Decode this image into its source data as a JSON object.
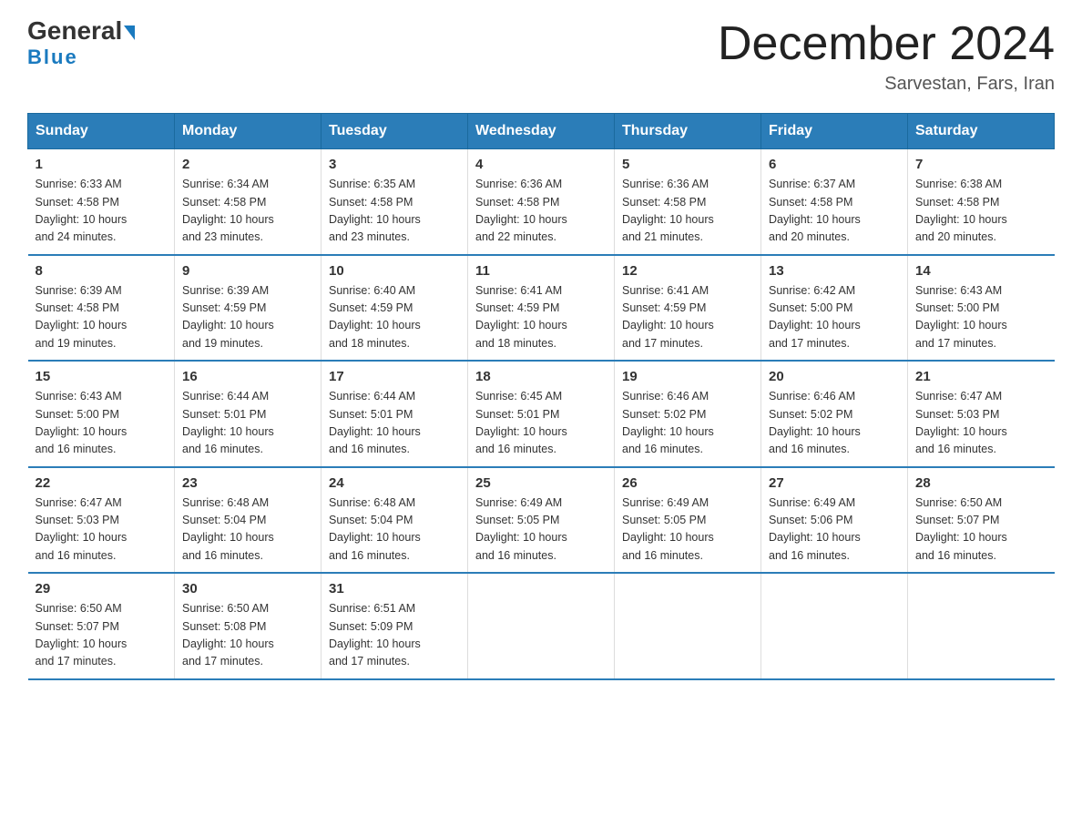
{
  "logo": {
    "part1": "General",
    "part2": "Blue"
  },
  "header": {
    "title": "December 2024",
    "subtitle": "Sarvestan, Fars, Iran"
  },
  "days_of_week": [
    "Sunday",
    "Monday",
    "Tuesday",
    "Wednesday",
    "Thursday",
    "Friday",
    "Saturday"
  ],
  "weeks": [
    [
      {
        "day": "1",
        "sunrise": "6:33 AM",
        "sunset": "4:58 PM",
        "daylight": "10 hours and 24 minutes."
      },
      {
        "day": "2",
        "sunrise": "6:34 AM",
        "sunset": "4:58 PM",
        "daylight": "10 hours and 23 minutes."
      },
      {
        "day": "3",
        "sunrise": "6:35 AM",
        "sunset": "4:58 PM",
        "daylight": "10 hours and 23 minutes."
      },
      {
        "day": "4",
        "sunrise": "6:36 AM",
        "sunset": "4:58 PM",
        "daylight": "10 hours and 22 minutes."
      },
      {
        "day": "5",
        "sunrise": "6:36 AM",
        "sunset": "4:58 PM",
        "daylight": "10 hours and 21 minutes."
      },
      {
        "day": "6",
        "sunrise": "6:37 AM",
        "sunset": "4:58 PM",
        "daylight": "10 hours and 20 minutes."
      },
      {
        "day": "7",
        "sunrise": "6:38 AM",
        "sunset": "4:58 PM",
        "daylight": "10 hours and 20 minutes."
      }
    ],
    [
      {
        "day": "8",
        "sunrise": "6:39 AM",
        "sunset": "4:58 PM",
        "daylight": "10 hours and 19 minutes."
      },
      {
        "day": "9",
        "sunrise": "6:39 AM",
        "sunset": "4:59 PM",
        "daylight": "10 hours and 19 minutes."
      },
      {
        "day": "10",
        "sunrise": "6:40 AM",
        "sunset": "4:59 PM",
        "daylight": "10 hours and 18 minutes."
      },
      {
        "day": "11",
        "sunrise": "6:41 AM",
        "sunset": "4:59 PM",
        "daylight": "10 hours and 18 minutes."
      },
      {
        "day": "12",
        "sunrise": "6:41 AM",
        "sunset": "4:59 PM",
        "daylight": "10 hours and 17 minutes."
      },
      {
        "day": "13",
        "sunrise": "6:42 AM",
        "sunset": "5:00 PM",
        "daylight": "10 hours and 17 minutes."
      },
      {
        "day": "14",
        "sunrise": "6:43 AM",
        "sunset": "5:00 PM",
        "daylight": "10 hours and 17 minutes."
      }
    ],
    [
      {
        "day": "15",
        "sunrise": "6:43 AM",
        "sunset": "5:00 PM",
        "daylight": "10 hours and 16 minutes."
      },
      {
        "day": "16",
        "sunrise": "6:44 AM",
        "sunset": "5:01 PM",
        "daylight": "10 hours and 16 minutes."
      },
      {
        "day": "17",
        "sunrise": "6:44 AM",
        "sunset": "5:01 PM",
        "daylight": "10 hours and 16 minutes."
      },
      {
        "day": "18",
        "sunrise": "6:45 AM",
        "sunset": "5:01 PM",
        "daylight": "10 hours and 16 minutes."
      },
      {
        "day": "19",
        "sunrise": "6:46 AM",
        "sunset": "5:02 PM",
        "daylight": "10 hours and 16 minutes."
      },
      {
        "day": "20",
        "sunrise": "6:46 AM",
        "sunset": "5:02 PM",
        "daylight": "10 hours and 16 minutes."
      },
      {
        "day": "21",
        "sunrise": "6:47 AM",
        "sunset": "5:03 PM",
        "daylight": "10 hours and 16 minutes."
      }
    ],
    [
      {
        "day": "22",
        "sunrise": "6:47 AM",
        "sunset": "5:03 PM",
        "daylight": "10 hours and 16 minutes."
      },
      {
        "day": "23",
        "sunrise": "6:48 AM",
        "sunset": "5:04 PM",
        "daylight": "10 hours and 16 minutes."
      },
      {
        "day": "24",
        "sunrise": "6:48 AM",
        "sunset": "5:04 PM",
        "daylight": "10 hours and 16 minutes."
      },
      {
        "day": "25",
        "sunrise": "6:49 AM",
        "sunset": "5:05 PM",
        "daylight": "10 hours and 16 minutes."
      },
      {
        "day": "26",
        "sunrise": "6:49 AM",
        "sunset": "5:05 PM",
        "daylight": "10 hours and 16 minutes."
      },
      {
        "day": "27",
        "sunrise": "6:49 AM",
        "sunset": "5:06 PM",
        "daylight": "10 hours and 16 minutes."
      },
      {
        "day": "28",
        "sunrise": "6:50 AM",
        "sunset": "5:07 PM",
        "daylight": "10 hours and 16 minutes."
      }
    ],
    [
      {
        "day": "29",
        "sunrise": "6:50 AM",
        "sunset": "5:07 PM",
        "daylight": "10 hours and 17 minutes."
      },
      {
        "day": "30",
        "sunrise": "6:50 AM",
        "sunset": "5:08 PM",
        "daylight": "10 hours and 17 minutes."
      },
      {
        "day": "31",
        "sunrise": "6:51 AM",
        "sunset": "5:09 PM",
        "daylight": "10 hours and 17 minutes."
      },
      {
        "day": "",
        "sunrise": "",
        "sunset": "",
        "daylight": ""
      },
      {
        "day": "",
        "sunrise": "",
        "sunset": "",
        "daylight": ""
      },
      {
        "day": "",
        "sunrise": "",
        "sunset": "",
        "daylight": ""
      },
      {
        "day": "",
        "sunrise": "",
        "sunset": "",
        "daylight": ""
      }
    ]
  ],
  "labels": {
    "sunrise": "Sunrise: ",
    "sunset": "Sunset: ",
    "daylight": "Daylight: "
  }
}
